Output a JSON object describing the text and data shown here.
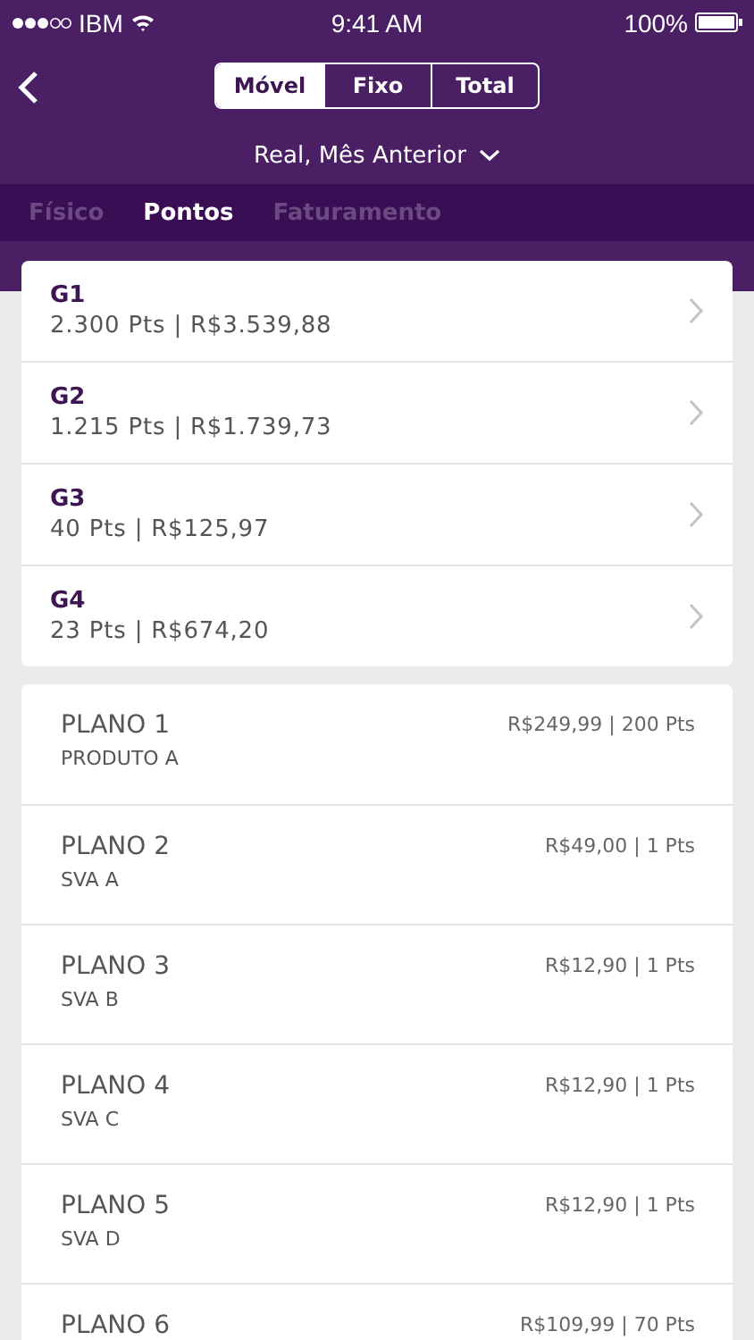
{
  "status_bar": {
    "carrier": "IBM",
    "time": "9:41 AM",
    "battery": "100%"
  },
  "segments": [
    {
      "label": "Móvel",
      "selected": true
    },
    {
      "label": "Fixo",
      "selected": false
    },
    {
      "label": "Total",
      "selected": false
    }
  ],
  "period": "Real, Mês Anterior",
  "tabs": [
    {
      "label": "Físico",
      "selected": false
    },
    {
      "label": "Pontos",
      "selected": true
    },
    {
      "label": "Faturamento",
      "selected": false
    }
  ],
  "groups": [
    {
      "name": "G1",
      "summary": "2.300 Pts | R$3.539,88"
    },
    {
      "name": "G2",
      "summary": "1.215 Pts | R$1.739,73"
    },
    {
      "name": "G3",
      "summary": "40 Pts | R$125,97"
    },
    {
      "name": "G4",
      "summary": "23 Pts | R$674,20"
    }
  ],
  "plans": [
    {
      "name": "PLANO 1",
      "product": "PRODUTO A",
      "value": "R$249,99 | 200 Pts"
    },
    {
      "name": "PLANO 2",
      "product": "SVA A",
      "value": "R$49,00 | 1 Pts"
    },
    {
      "name": "PLANO 3",
      "product": "SVA B",
      "value": "R$12,90 | 1 Pts"
    },
    {
      "name": "PLANO 4",
      "product": "SVA C",
      "value": "R$12,90 | 1 Pts"
    },
    {
      "name": "PLANO 5",
      "product": "SVA D",
      "value": "R$12,90 | 1 Pts"
    },
    {
      "name": "PLANO 6",
      "value": "R$109,99 | 70 Pts"
    }
  ]
}
